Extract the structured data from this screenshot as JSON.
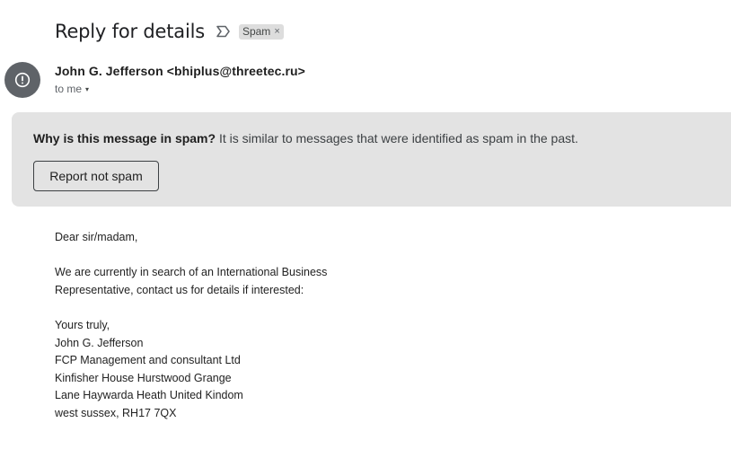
{
  "message": {
    "subject": "Reply for details",
    "label": "Spam",
    "label_remove": "×",
    "sender": "John G. Jefferson <bhiplus@threetec.ru>",
    "recipient": "to me",
    "recipient_caret": "▾"
  },
  "spam_banner": {
    "question": "Why is this message in spam?",
    "explanation": "It is similar to messages that were identified as spam in the past.",
    "report_button": "Report not spam"
  },
  "body": {
    "greeting": "Dear sir/madam,",
    "paragraph_lines": [
      "We are currently in search of an International Business",
      "Representative, contact us for details if interested:"
    ],
    "signature_lines": [
      "Yours truly,",
      "John G. Jefferson",
      "FCP Management and consultant Ltd",
      "Kinfisher House Hurstwood Grange",
      "Lane Haywarda Heath United Kindom",
      "west sussex, RH17 7QX"
    ]
  },
  "icons": {
    "importance": "importance-marker-icon",
    "avatar": "warning-icon"
  },
  "colors": {
    "banner_bg": "#e3e3e3",
    "avatar_bg": "#5f6368",
    "label_bg": "#dddddd"
  }
}
